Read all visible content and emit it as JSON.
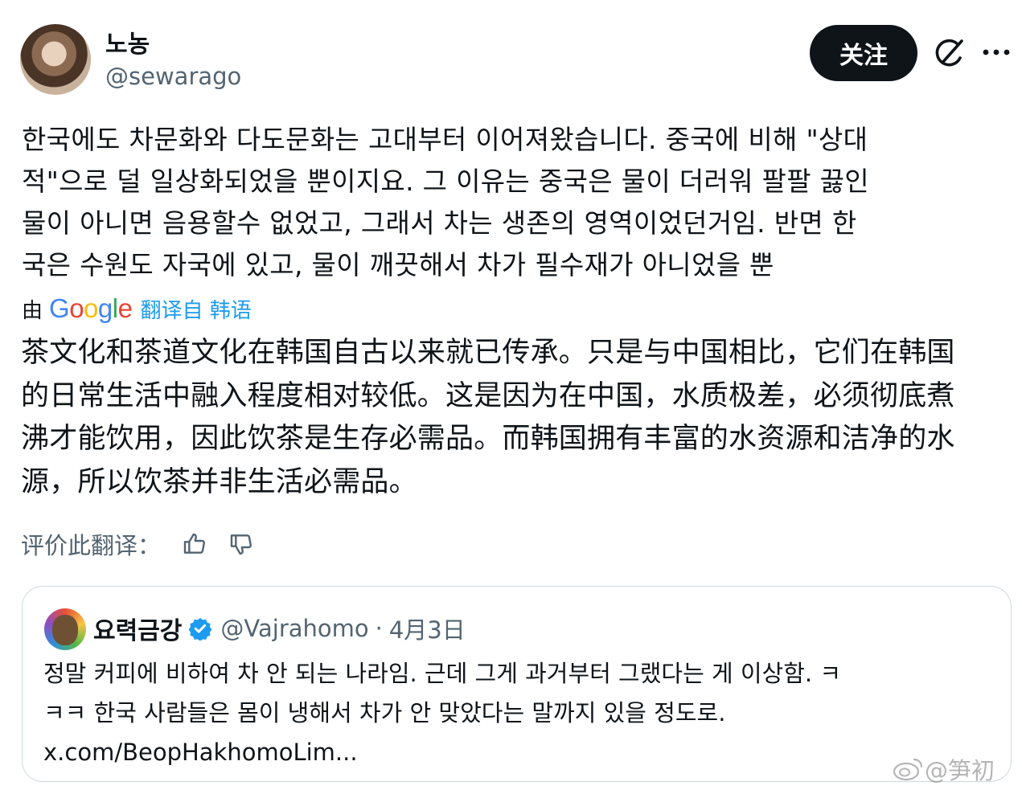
{
  "author": {
    "display_name": "노농",
    "handle": "@sewarago"
  },
  "actions": {
    "follow_label": "关注",
    "grok_icon": "grok-icon",
    "more_icon": "more-icon"
  },
  "post": {
    "lines": [
      "한국에도 차문화와 다도문화는 고대부터 이어져왔습니다. 중국에 비해 \"상대",
      "적\"으로 덜 일상화되었을 뿐이지요. 그 이유는 중국은 물이 더러워 팔팔 끓인",
      "물이 아니면 음용할수 없었고, 그래서 차는 생존의 영역이었던거임. 반면 한",
      "국은 수원도 자국에 있고, 물이 깨끗해서 차가 필수재가 아니었을 뿐"
    ]
  },
  "translation": {
    "by_label": "由",
    "provider": "Google",
    "provider_colors": [
      "#4285F4",
      "#EA4335",
      "#FBBC05",
      "#4285F4",
      "#34A853",
      "#EA4335"
    ],
    "source_label": "翻译自 韩语",
    "lines": [
      "茶文化和茶道文化在韩国自古以来就已传承。只是与中国相比，它们在韩国",
      "的日常生活中融入程度相对较低。这是因为在中国，水质极差，必须彻底煮",
      "沸才能饮用，因此饮茶是生存必需品。而韩国拥有丰富的水资源和洁净的水",
      "源，所以饮茶并非生活必需品。"
    ],
    "rate_label": "评价此翻译："
  },
  "quote": {
    "display_name": "요력금강",
    "handle": "@Vajrahomo",
    "separator": "·",
    "date": "4月3日",
    "verified_color": "#1d9bf0",
    "lines": [
      "정말 커피에 비하여 차 안 되는 나라임. 근데 그게 과거부터 그랬다는 게 이상함. ㅋ",
      "ㅋㅋ 한국 사람들은 몸이 냉해서 차가 안 맞았다는 말까지 있을 정도로."
    ],
    "link": "x.com/BeopHakhomoLim..."
  },
  "watermark": "@笋初"
}
